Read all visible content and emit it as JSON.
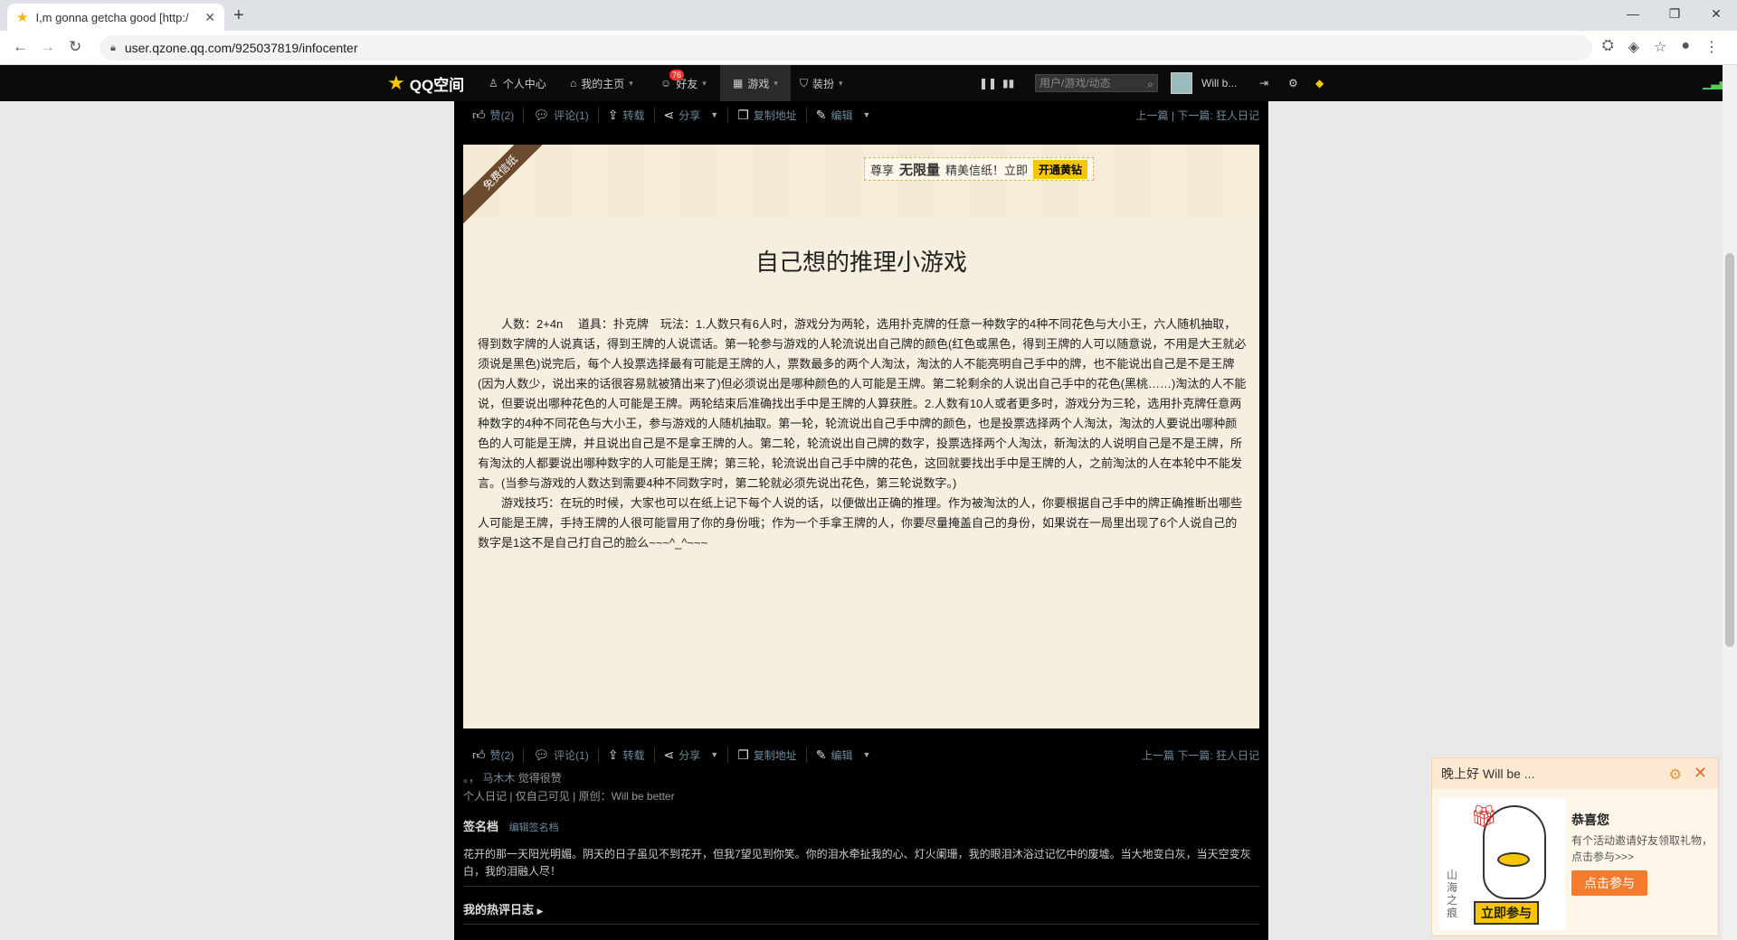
{
  "browser": {
    "tab_title": "I,m gonna getcha good [http:/",
    "new_tab": "+",
    "url": "user.qzone.qq.com/925037819/infocenter",
    "win_min": "—",
    "win_max": "❐",
    "win_close": "✕"
  },
  "qzone_bar": {
    "logo": "QQ空间",
    "personal_center": "个人中心",
    "my_home": "我的主页",
    "friends": "好友",
    "friends_badge": "76",
    "games": "游戏",
    "decorate": "装扮",
    "search_placeholder": "用户/游戏/动态",
    "username": "Will b..."
  },
  "article_actions": {
    "like": "赞(2)",
    "comment": "评论(1)",
    "repost": "转载",
    "share": "分享",
    "copy_url": "复制地址",
    "edit": "编辑",
    "nav": "上一篇 | 下一篇: 狂人日记",
    "nav_bottom": "上一篇 下一篇: 狂人日记"
  },
  "paper": {
    "ribbon": "免费信纸",
    "promo_pre": "尊享",
    "promo_bold": "无限量",
    "promo_post": "精美信纸！立即",
    "promo_btn": "开通黄钻",
    "title": "自己想的推理小游戏",
    "para1": "人数：2+4n　 道具：扑克牌　玩法：1.人数只有6人时，游戏分为两轮，选用扑克牌的任意一种数字的4种不同花色与大小王，六人随机抽取，得到数字牌的人说真话，得到王牌的人说谎话。第一轮参与游戏的人轮流说出自己牌的颜色(红色或黑色，得到王牌的人可以随意说，不用是大王就必须说是黑色)说完后，每个人投票选择最有可能是王牌的人，票数最多的两个人淘汰，淘汰的人不能亮明自己手中的牌，也不能说出自己是不是王牌(因为人数少，说出来的话很容易就被猜出来了)但必须说出是哪种颜色的人可能是王牌。第二轮剩余的人说出自己手中的花色(黑桃……)淘汰的人不能说，但要说出哪种花色的人可能是王牌。两轮结束后准确找出手中是王牌的人算获胜。2.人数有10人或者更多时，游戏分为三轮，选用扑克牌任意两种数字的4种不同花色与大小王，参与游戏的人随机抽取。第一轮，轮流说出自己手中牌的颜色，也是投票选择两个人淘汰，淘汰的人要说出哪种颜色的人可能是王牌，并且说出自己是不是拿王牌的人。第二轮，轮流说出自己牌的数字，投票选择两个人淘汰，新淘汰的人说明自己是不是王牌，所有淘汰的人都要说出哪种数字的人可能是王牌；第三轮，轮流说出自己手中牌的花色，这回就要找出手中是王牌的人，之前淘汰的人在本轮中不能发言。(当参与游戏的人数达到需要4种不同数字时，第二轮就必须先说出花色，第三轮说数字。)",
    "para2": "游戏技巧：在玩的时候，大家也可以在纸上记下每个人说的话，以便做出正确的推理。作为被淘汰的人，你要根据自己手中的牌正确推断出哪些人可能是王牌，手持王牌的人很可能冒用了你的身份哦；作为一个手拿王牌的人，你要尽量掩盖自己的身份，如果说在一局里出现了6个人说自己的数字是1这不是自己打自己的脸么~~~^_^~~~"
  },
  "meta": {
    "likers_prefix": "。，",
    "likers": "马木木",
    "likers_suffix": "觉得很赞",
    "info": "个人日记 | 仅自己可见 | 原创：Will be better"
  },
  "signature": {
    "heading": "签名档",
    "edit": "编辑签名档",
    "text": "花开的那一天阳光明媚。阴天的日子虽见不到花开，但我7望见到你笑。你的泪水牵扯我的心、灯火阑珊，我的眼泪沐浴过记忆中的废墟。当大地变白灰，当天空变灰白，我的泪融人尽！"
  },
  "hot_blogs": "我的热评日志",
  "popup": {
    "greeting": "晚上好 Will be ...",
    "title": "恭喜您",
    "desc": "有个活动邀请好友领取礼物，点击参与>>>",
    "button": "点击参与",
    "join_badge": "立即参与",
    "side_text": "山海之痕"
  }
}
